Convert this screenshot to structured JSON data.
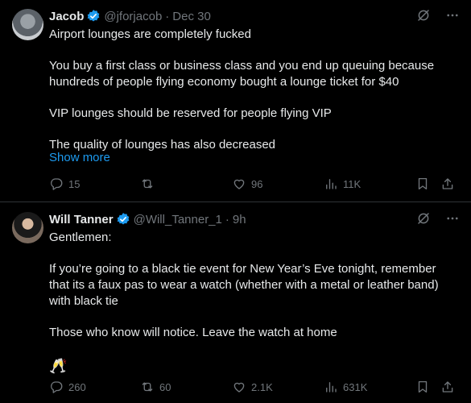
{
  "tweets": [
    {
      "name": "Jacob",
      "handle": "@jforjacob",
      "separator": "·",
      "time": "Dec 30",
      "paragraphs": [
        "Airport lounges are completely fucked",
        "You buy a first class or business class and you end up queuing because hundreds of people flying economy bought a lounge ticket for $40",
        "VIP lounges should be reserved for people flying VIP",
        "The quality of lounges has also decreased"
      ],
      "show_more": "Show more",
      "replies": "15",
      "reposts": "",
      "likes": "96",
      "views": "11K"
    },
    {
      "name": "Will Tanner",
      "handle": "@Will_Tanner_1",
      "separator": "·",
      "time": "9h",
      "paragraphs": [
        "Gentlemen:",
        "If you’re going to a black tie event for New Year’s Eve tonight, remember that its a faux pas to wear a watch (whether with a metal or leather band) with black tie",
        "Those who know will notice. Leave the watch at home",
        "🥂"
      ],
      "replies": "260",
      "reposts": "60",
      "likes": "2.1K",
      "views": "631K"
    }
  ],
  "icons": {
    "verified": "verified-badge-icon",
    "grok": "grok-icon",
    "more": "more-icon",
    "reply": "reply-icon",
    "repost": "repost-icon",
    "like": "like-icon",
    "views": "views-icon",
    "bookmark": "bookmark-icon",
    "share": "share-icon"
  },
  "colors": {
    "background": "#000000",
    "text": "#e7e9ea",
    "muted": "#71767b",
    "accent": "#1d9bf0",
    "divider": "#2f3336"
  }
}
